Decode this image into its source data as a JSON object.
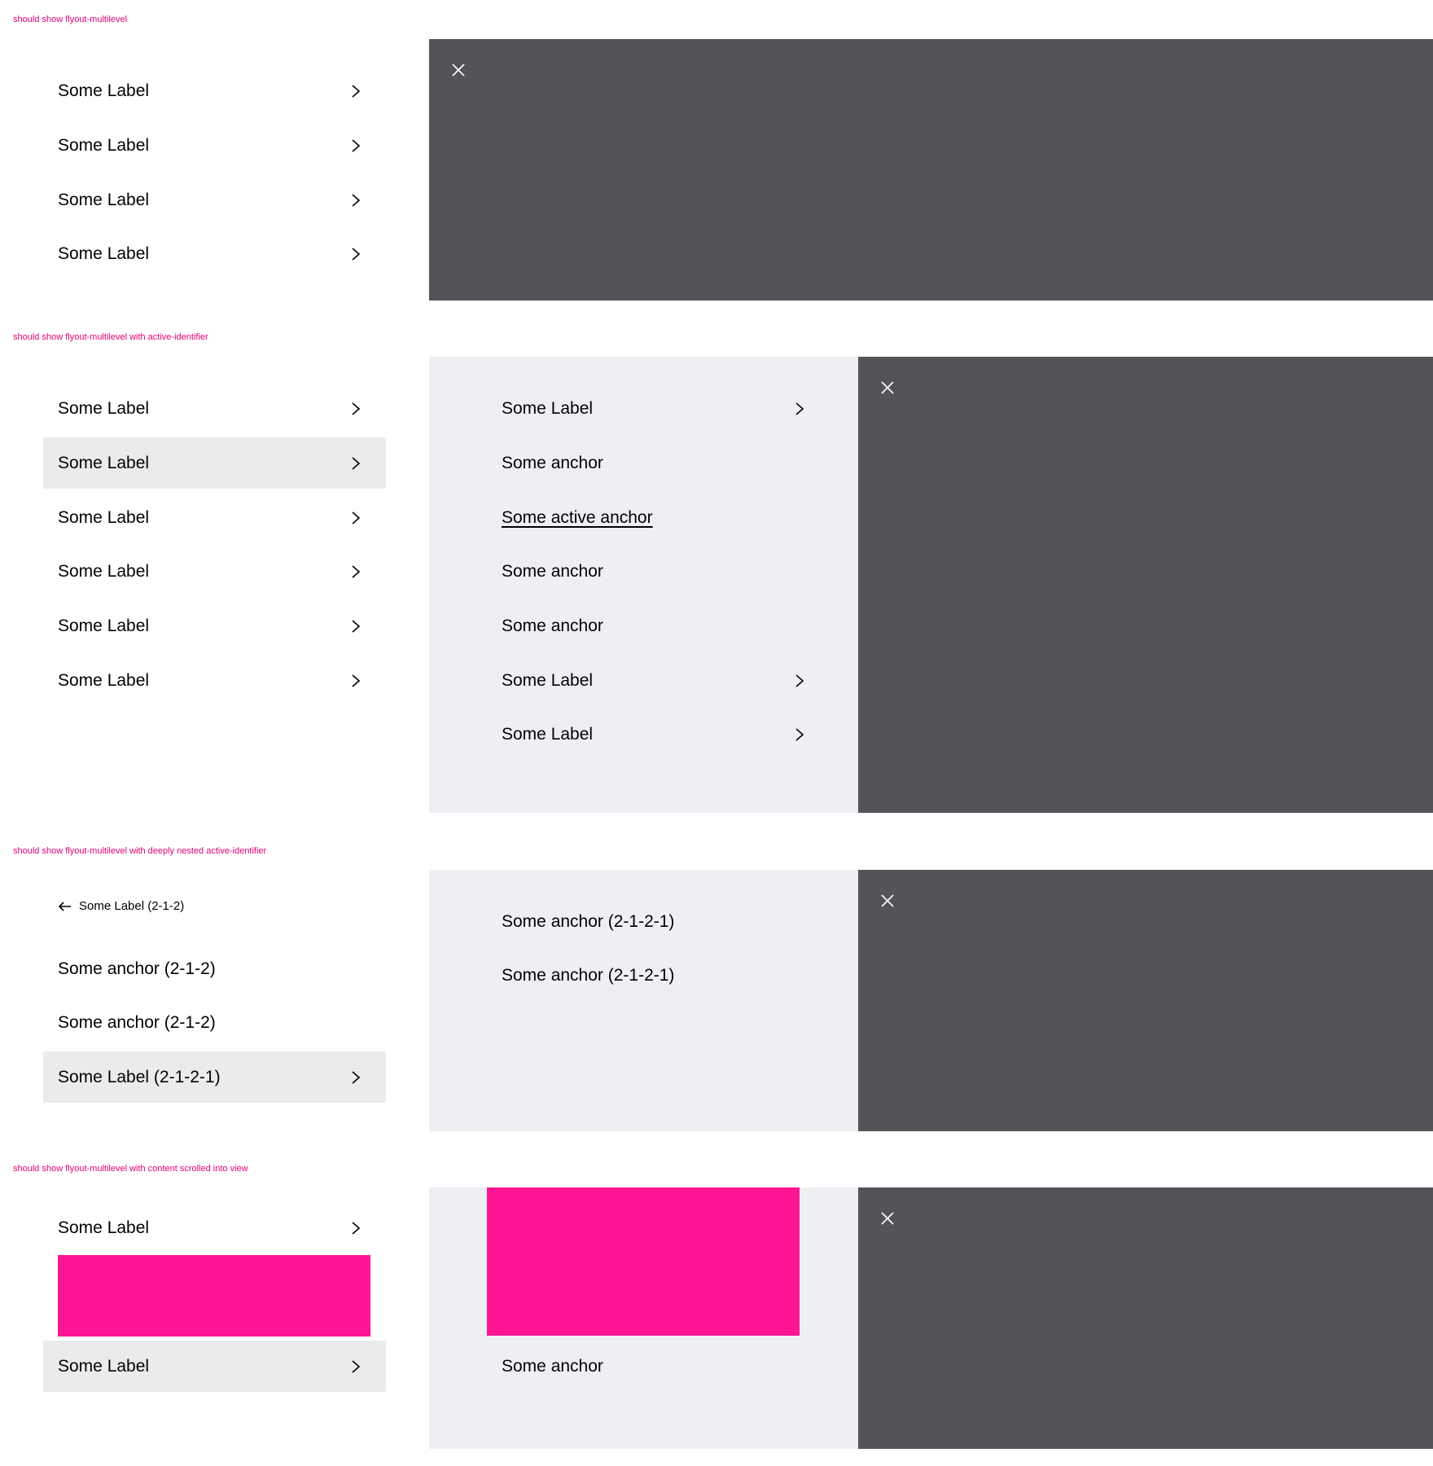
{
  "colors": {
    "title": "#e20074",
    "backdrop": "#535457",
    "level2_bg": "#eeeff2",
    "active_bg": "#ebebeb",
    "slot": "#ff1493"
  },
  "icons": {
    "chevron": "chevron-right-icon",
    "close": "close-icon",
    "back": "arrow-left-icon"
  },
  "examples": [
    {
      "title": "should show flyout-multilevel",
      "level1": [
        "Some Label",
        "Some Label",
        "Some Label",
        "Some Label"
      ]
    },
    {
      "title": "should show flyout-multilevel with active-identifier",
      "level1": [
        "Some Label",
        "Some Label",
        "Some Label",
        "Some Label",
        "Some Label",
        "Some Label"
      ],
      "level2": [
        "Some Label",
        "Some anchor",
        "Some active anchor",
        "Some anchor",
        "Some anchor",
        "Some Label",
        "Some Label"
      ]
    },
    {
      "title": "should show flyout-multilevel with deeply nested active-identifier",
      "back_label": "Some Label (2-1-2)",
      "level1": [
        "Some anchor (2-1-2)",
        "Some anchor (2-1-2)",
        "Some Label (2-1-2-1)"
      ],
      "level2": [
        "Some anchor (2-1-2-1)",
        "Some anchor (2-1-2-1)"
      ]
    },
    {
      "title": "should show flyout-multilevel with content scrolled into view",
      "level1": [
        "Some Label",
        "Some Label"
      ],
      "level2": [
        "Some anchor"
      ]
    }
  ]
}
